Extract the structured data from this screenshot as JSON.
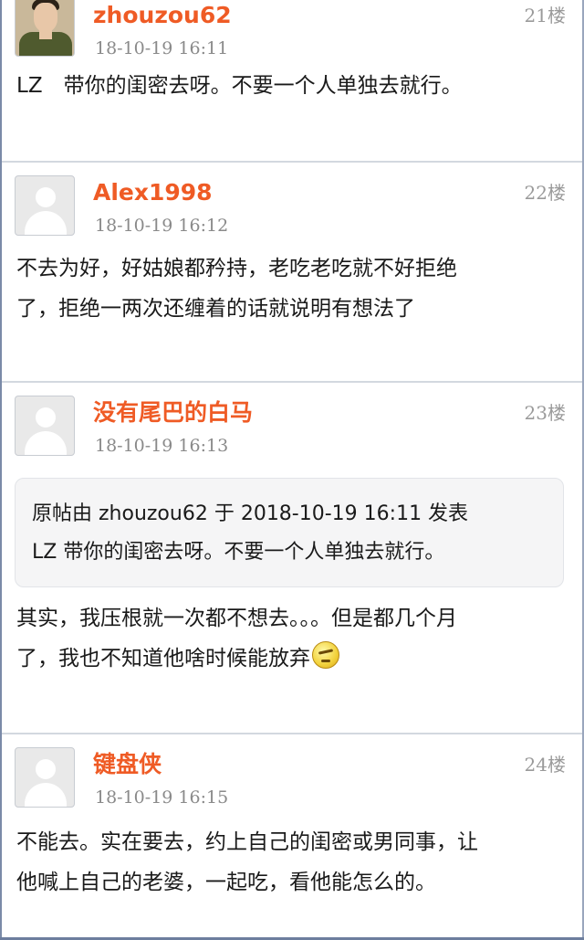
{
  "posts": [
    {
      "username": "zhouzou62",
      "floor": "21楼",
      "time": "18-10-19 16:11",
      "avatar": "user-photo",
      "content": "LZ　带你的闺密去呀。不要一个人单独去就行。"
    },
    {
      "username": "Alex1998",
      "floor": "22楼",
      "time": "18-10-19 16:12",
      "avatar": "default-avatar",
      "content_lines": [
        "不去为好，好姑娘都矜持，老吃老吃就不好拒绝",
        "了，拒绝一两次还缠着的话就说明有想法了"
      ]
    },
    {
      "username": "没有尾巴的白马",
      "floor": "23楼",
      "time": "18-10-19 16:13",
      "avatar": "default-avatar",
      "quote": {
        "header": "原帖由 zhouzou62 于 2018-10-19 16:11 发表",
        "text": "LZ 带你的闺密去呀。不要一个人单独去就行。"
      },
      "content_lines": [
        "其实，我压根就一次都不想去。。。但是都几个月",
        "了，我也不知道他啥时候能放弃"
      ],
      "emoji": "frowning-face-emoji"
    },
    {
      "username": "键盘侠",
      "floor": "24楼",
      "time": "18-10-19 16:15",
      "avatar": "default-avatar",
      "content_lines": [
        "不能去。实在要去，约上自己的闺密或男同事，让",
        "他喊上自己的老婆，一起吃，看他能怎么的。"
      ]
    }
  ],
  "colors": {
    "username": "#ef5b25",
    "meta": "#8a8a8a",
    "separator": "#d3d8df",
    "quote_bg": "#f5f5f6"
  }
}
